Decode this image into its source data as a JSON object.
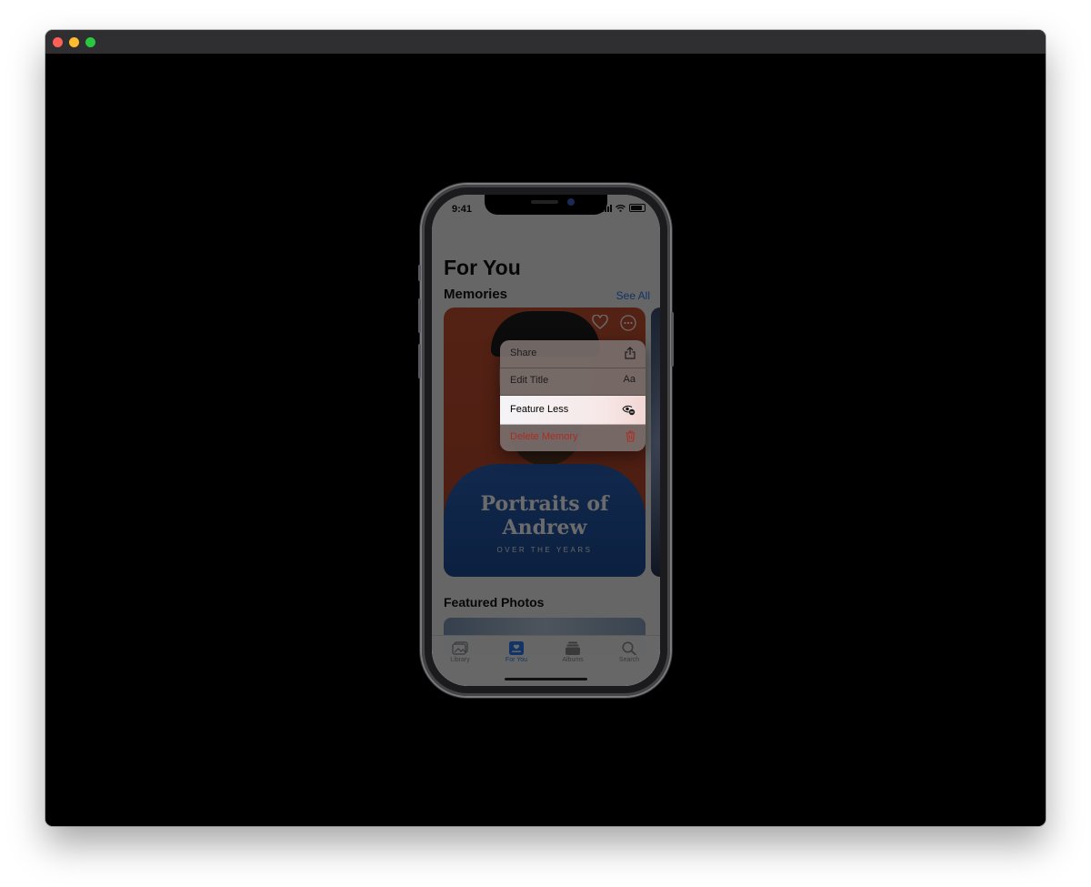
{
  "status_bar": {
    "time": "9:41"
  },
  "page": {
    "title": "For You"
  },
  "memories": {
    "heading": "Memories",
    "see_all": "See All",
    "card": {
      "title": "Portraits of Andrew",
      "subtitle": "OVER THE YEARS"
    }
  },
  "context_menu": {
    "items": [
      {
        "label": "Share",
        "icon": "share-icon",
        "highlighted": false,
        "destructive": false
      },
      {
        "label": "Edit Title",
        "icon_text": "Aa",
        "highlighted": false,
        "destructive": false
      },
      {
        "label": "Feature Less",
        "icon": "feature-less-icon",
        "highlighted": true,
        "destructive": false
      },
      {
        "label": "Delete Memory",
        "icon": "trash-icon",
        "highlighted": false,
        "destructive": true
      }
    ],
    "colors": {
      "highlight": "#f4f4f6",
      "destructive": "#b22a20"
    }
  },
  "featured": {
    "heading": "Featured Photos"
  },
  "tab_bar": {
    "tabs": [
      {
        "label": "Library",
        "active": false
      },
      {
        "label": "For You",
        "active": true
      },
      {
        "label": "Albums",
        "active": false
      },
      {
        "label": "Search",
        "active": false
      }
    ],
    "active_color": "#2b7bf0"
  }
}
